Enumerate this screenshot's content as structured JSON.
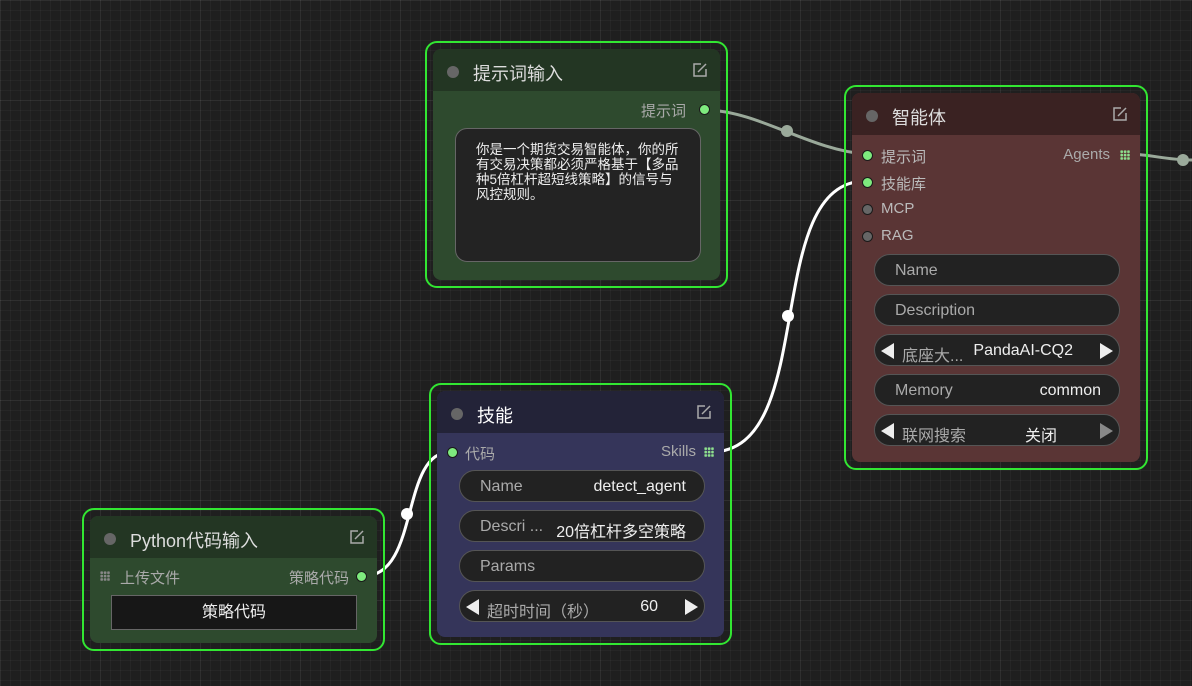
{
  "colors": {
    "selection": "#32e632",
    "green_node": "#2e4a2e",
    "agent_node": "#5a3535",
    "skill_node": "#35355a",
    "link": "#ffffff"
  },
  "prompt_node": {
    "title": "提示词输入",
    "output_label": "提示词",
    "text": "你是一个期货交易智能体，你的所有交易决策都必须严格基于【多品种5倍杠杆超短线策略】的信号与风控规则。"
  },
  "agent_node": {
    "title": "智能体",
    "inputs": [
      "提示词",
      "技能库",
      "MCP",
      "RAG"
    ],
    "output_label": "Agents",
    "widgets": {
      "name_label": "Name",
      "description_label": "Description",
      "model_label": "底座大...",
      "model_value": "PandaAI-CQ2",
      "memory_label": "Memory",
      "memory_value": "common",
      "search_label": "联网搜索",
      "search_value": "关闭"
    }
  },
  "skill_node": {
    "title": "技能",
    "input_label": "代码",
    "output_label": "Skills",
    "widgets": {
      "name_label": "Name",
      "name_value": "detect_agent",
      "desc_label": "Descri ...",
      "desc_value": "20倍杠杆多空策略",
      "params_label": "Params",
      "timeout_label": "超时时间（秒）",
      "timeout_value": "60"
    }
  },
  "python_node": {
    "title": "Python代码输入",
    "input_label": "上传文件",
    "output_label": "策略代码",
    "button_label": "策略代码"
  }
}
